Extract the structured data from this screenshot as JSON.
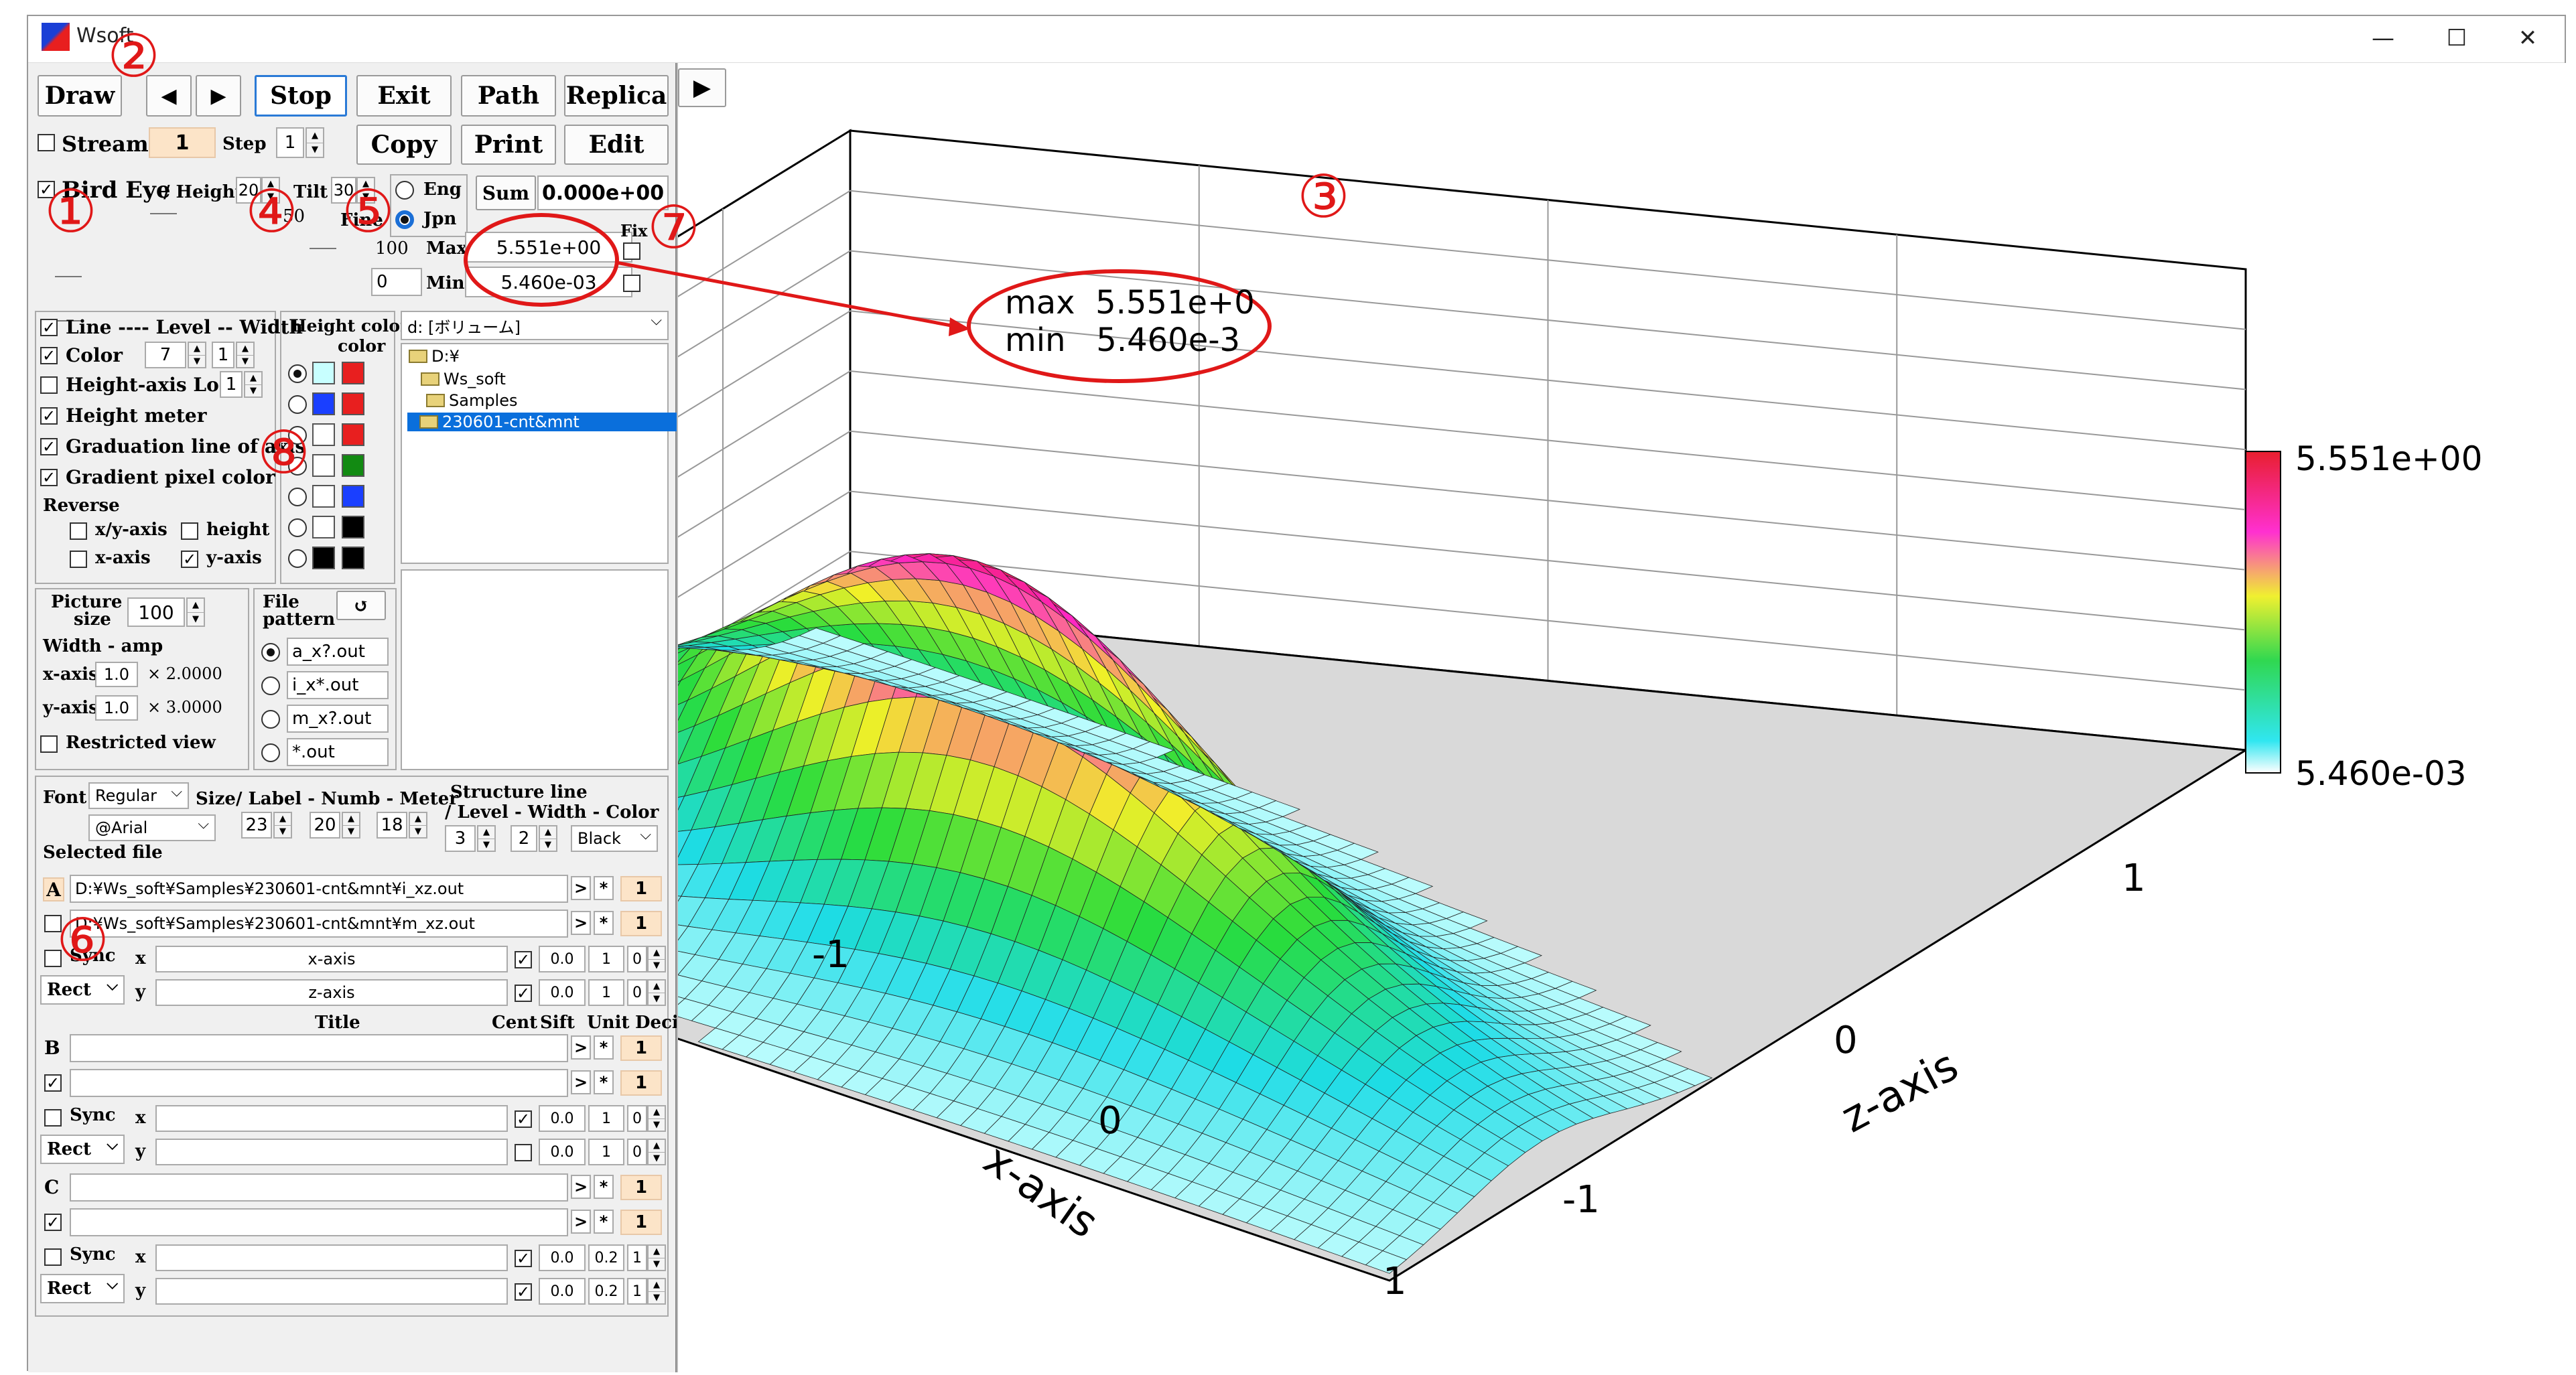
{
  "window": {
    "title": "Wsoft",
    "minimize": "—",
    "maximize": "☐",
    "close": "✕"
  },
  "toolbar": {
    "draw": "Draw",
    "prev": "◀",
    "next": "▶",
    "stop": "Stop",
    "exit": "Exit",
    "path": "Path",
    "replica": "Replica",
    "copy": "Copy",
    "print": "Print",
    "edit": "Edit",
    "play": "▶"
  },
  "stream": {
    "label": "Stream",
    "value": "1",
    "step_label": "Step",
    "step_value": "1"
  },
  "birdeye": {
    "label": "Bird Eye",
    "height_label": "/ Height",
    "height_value": "20",
    "tilt_label": "Tilt",
    "tilt_value": "30",
    "eng": "Eng",
    "jpn": "Jpn",
    "fine": "Fine",
    "v50": "50",
    "v100": "100",
    "v0": "0"
  },
  "stats": {
    "sum_label": "Sum",
    "sum_value": "0.000e+00",
    "max_label": "Max",
    "max_value": "5.551e+00",
    "min_label": "Min",
    "min_value": "5.460e-03",
    "fix": "Fix"
  },
  "callout": {
    "line1": "max  5.551e+0",
    "line2": "min   5.460e-3"
  },
  "options": {
    "line": "Line ---- Level -- Width",
    "color": "Color",
    "color_a": "7",
    "color_b": "1",
    "height_axis_log": "Height-axis Log",
    "log_value": "1",
    "height_meter": "Height meter",
    "graduation": "Graduation line of axis",
    "gradient": "Gradient pixel color",
    "reverse": "Reverse",
    "xy_axis": "x/y-axis",
    "height": "height",
    "x_axis": "x-axis",
    "y_axis": "y-axis",
    "height_color": "Height color",
    "height_color_2": "color"
  },
  "drive": {
    "label": "d: [ボリューム]"
  },
  "tree": {
    "items": [
      "D:¥",
      "Ws_soft",
      "Samples",
      "230601-cnt&mnt"
    ]
  },
  "picture": {
    "size_label": "Picture",
    "size_label2": "size",
    "size_value": "100",
    "width_amp": "Width - amp",
    "x_label": "x-axis",
    "x_value": "1.0",
    "x_mult": "× 2.0000",
    "y_label": "y-axis",
    "y_value": "1.0",
    "y_mult": "× 3.0000",
    "restricted": "Restricted view"
  },
  "pattern": {
    "label": "File",
    "label2": "pattern",
    "refresh": "↺",
    "items": [
      "a_x?.out",
      "i_x*.out",
      "m_x?.out",
      "*.out"
    ]
  },
  "font": {
    "label": "Font",
    "style": "Regular",
    "face": "@Arial",
    "sizes_label": "Size/ Label - Numb - Meter",
    "size_label": "23",
    "size_numb": "20",
    "size_meter": "18",
    "struct_label": "Structure line",
    "struct_label2": "/ Level - Width - Color",
    "struct_level": "3",
    "struct_width": "2",
    "struct_color": "Black"
  },
  "files": {
    "selected_label": "Selected file",
    "a_tag": "A",
    "a_path1": "D:¥Ws_soft¥Samples¥230601-cnt&mnt¥i_xz.out",
    "a_path2": "D:¥Ws_soft¥Samples¥230601-cnt&mnt¥m_xz.out",
    "count": "1",
    "arrow": ">",
    "star": "*",
    "sync": "Sync",
    "x": "x",
    "y": "y",
    "rect": "Rect",
    "xaxis_title": "x-axis",
    "zaxis_title": "z-axis",
    "cent": "0.0",
    "unit_a": "1",
    "deci_a": "0",
    "unit_c": "0.2",
    "deci_c": "1",
    "col_title": "Title",
    "col_cent": "Cent",
    "col_sift": "Sift",
    "col_unit": "Unit",
    "col_deci": "Deci",
    "b_tag": "B",
    "c_tag": "C"
  },
  "markers": [
    "①",
    "②",
    "③",
    "④",
    "⑤",
    "⑥",
    "⑦",
    "⑧"
  ],
  "plot": {
    "x_axis_label": "x-axis",
    "z_axis_label": "z-axis",
    "x_ticks": [
      "-1",
      "0",
      "1"
    ],
    "z_ticks": [
      "-1",
      "0",
      "1"
    ],
    "colorbar_max": "5.551e+00",
    "colorbar_min": "5.460e-03"
  },
  "colors": {
    "marker_red": "#e01818",
    "accent_blue": "#2a7ad6",
    "peach": "#fce4c8"
  }
}
